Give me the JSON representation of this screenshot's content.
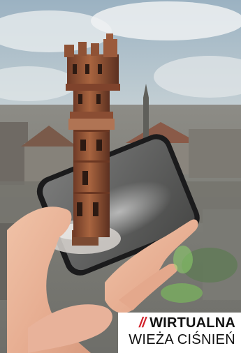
{
  "caption": {
    "slashes": "//",
    "title_line1": "WIRTUALNA",
    "title_line2": "WIEŻA CIŚNIEŃ"
  },
  "colors": {
    "accent_red": "#d1202a",
    "text": "#111111",
    "tower_brick": "#9a5a3c"
  }
}
